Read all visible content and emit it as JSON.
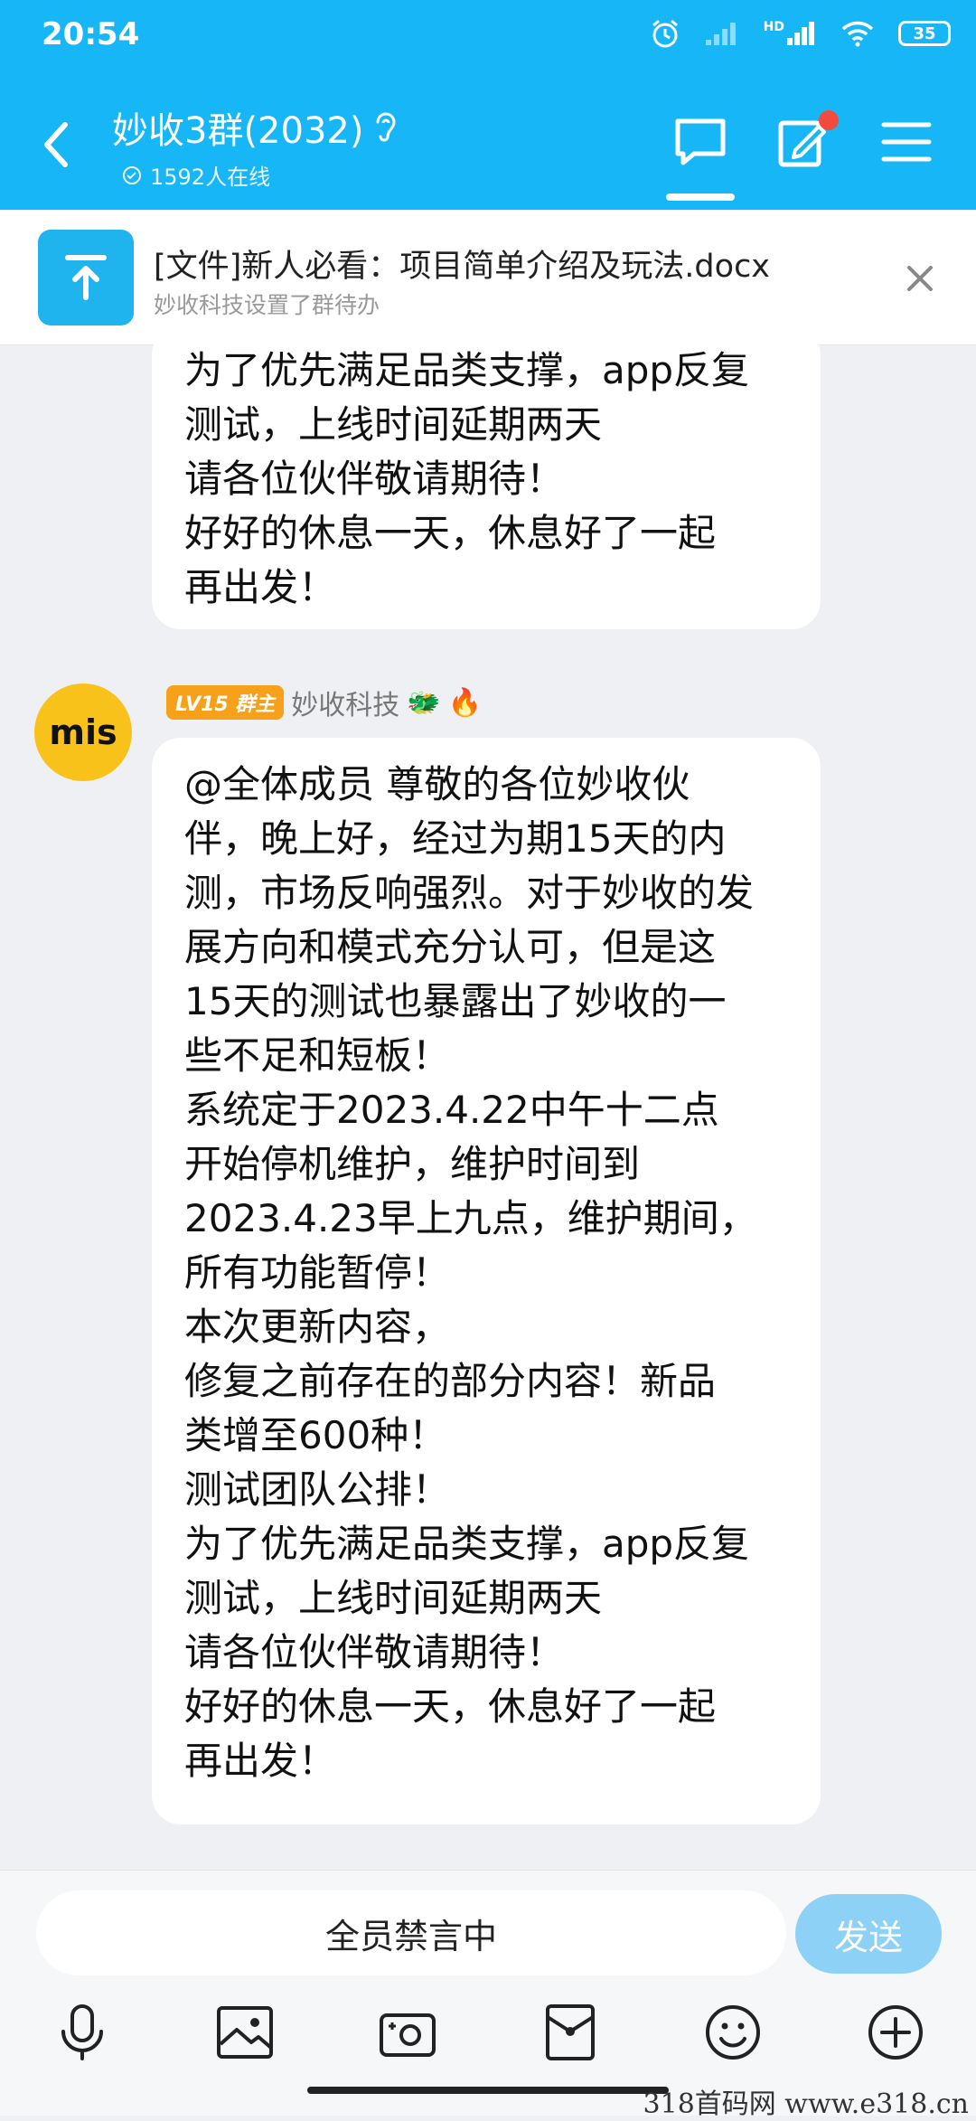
{
  "status_bar": {
    "time": "20:54",
    "battery": "35",
    "network": "HD"
  },
  "header": {
    "group_name": "妙收3群(2032)",
    "online": "1592人在线"
  },
  "pinned": {
    "title": "[文件]新人必看：项目简单介绍及玩法.docx",
    "subtitle": "妙收科技设置了群待办"
  },
  "messages": [
    {
      "lines": [
        "为了优先满足品类支撑，app反复",
        "测试，上线时间延期两天",
        "请各位伙伴敬请期待！",
        "好好的休息一天，休息好了一起",
        "再出发！"
      ]
    },
    {
      "avatar_text": "mis",
      "badge": "LV15 群主",
      "sender": "妙收科技",
      "lines": [
        "@全体成员 尊敬的各位妙收伙",
        "伴，晚上好，经过为期15天的内",
        "测，市场反响强烈。对于妙收的发",
        "展方向和模式充分认可，但是这",
        "15天的测试也暴露出了妙收的一",
        "些不足和短板！",
        "系统定于2023.4.22中午十二点",
        "开始停机维护，维护时间到",
        "2023.4.23早上九点，维护期间，",
        "所有功能暂停！",
        "本次更新内容，",
        "修复之前存在的部分内容！新品",
        "类增至600种！",
        "测试团队公排！",
        "为了优先满足品类支撑，app反复",
        "测试，上线时间延期两天",
        "请各位伙伴敬请期待！",
        "好好的休息一天，休息好了一起",
        "再出发！"
      ]
    }
  ],
  "composer": {
    "muted_text": "全员禁言中",
    "send_label": "发送"
  },
  "watermark": "318首码网  www.e318.cn"
}
